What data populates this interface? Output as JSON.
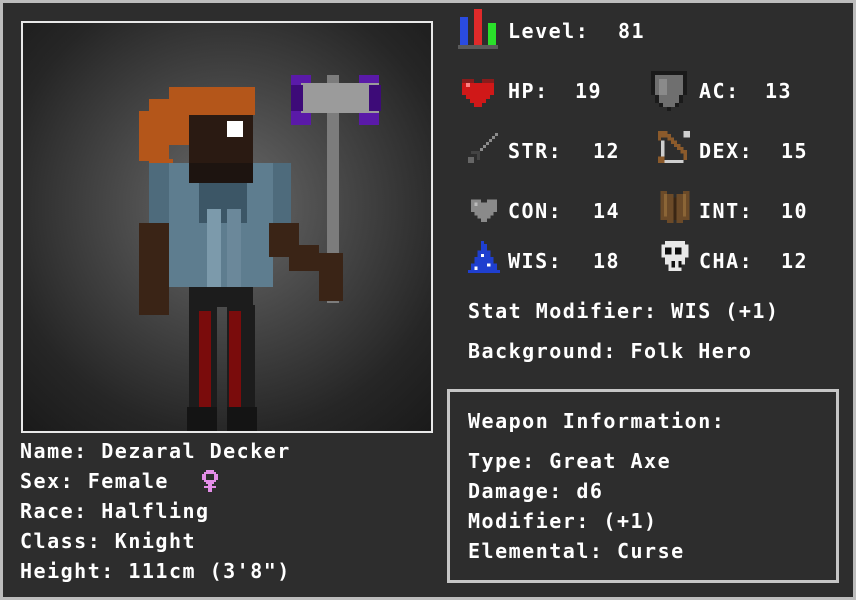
{
  "level": {
    "label": "Level:",
    "value": "81"
  },
  "stats": {
    "hp": {
      "label": "HP:",
      "value": "19"
    },
    "ac": {
      "label": "AC:",
      "value": "13"
    },
    "str": {
      "label": "STR:",
      "value": "12"
    },
    "dex": {
      "label": "DEX:",
      "value": "15"
    },
    "con": {
      "label": "CON:",
      "value": "14"
    },
    "int": {
      "label": "INT:",
      "value": "10"
    },
    "wis": {
      "label": "WIS:",
      "value": "18"
    },
    "cha": {
      "label": "CHA:",
      "value": "12"
    }
  },
  "stat_modifier": "Stat Modifier: WIS (+1)",
  "background": "Background: Folk Hero",
  "character": {
    "name": "Name: Dezaral Decker",
    "sex": "Sex: Female",
    "race": "Race: Halfling",
    "class": "Class: Knight",
    "height": "Height: 111cm (3'8\")"
  },
  "weapon": {
    "title": "Weapon Information:",
    "type": "Type: Great Axe",
    "damage": "Damage: d6",
    "modifier": "Modifier: (+1)",
    "elemental": "Elemental: Curse"
  },
  "icons": {
    "level": "level-bars-icon",
    "hp": "heart-icon",
    "ac": "shield-icon",
    "str": "sword-icon",
    "dex": "bow-icon",
    "con": "grey-heart-icon",
    "int": "book-icon",
    "wis": "wizard-hat-icon",
    "cha": "skull-icon",
    "sex": "female-symbol-icon"
  },
  "colors": {
    "background": "#2d2d2d",
    "frame": "#bdbdbd",
    "text": "#ffffff",
    "female_symbol": "#e48ee8",
    "hair": "#b4561a",
    "axe_head": "#5a1aa8"
  }
}
